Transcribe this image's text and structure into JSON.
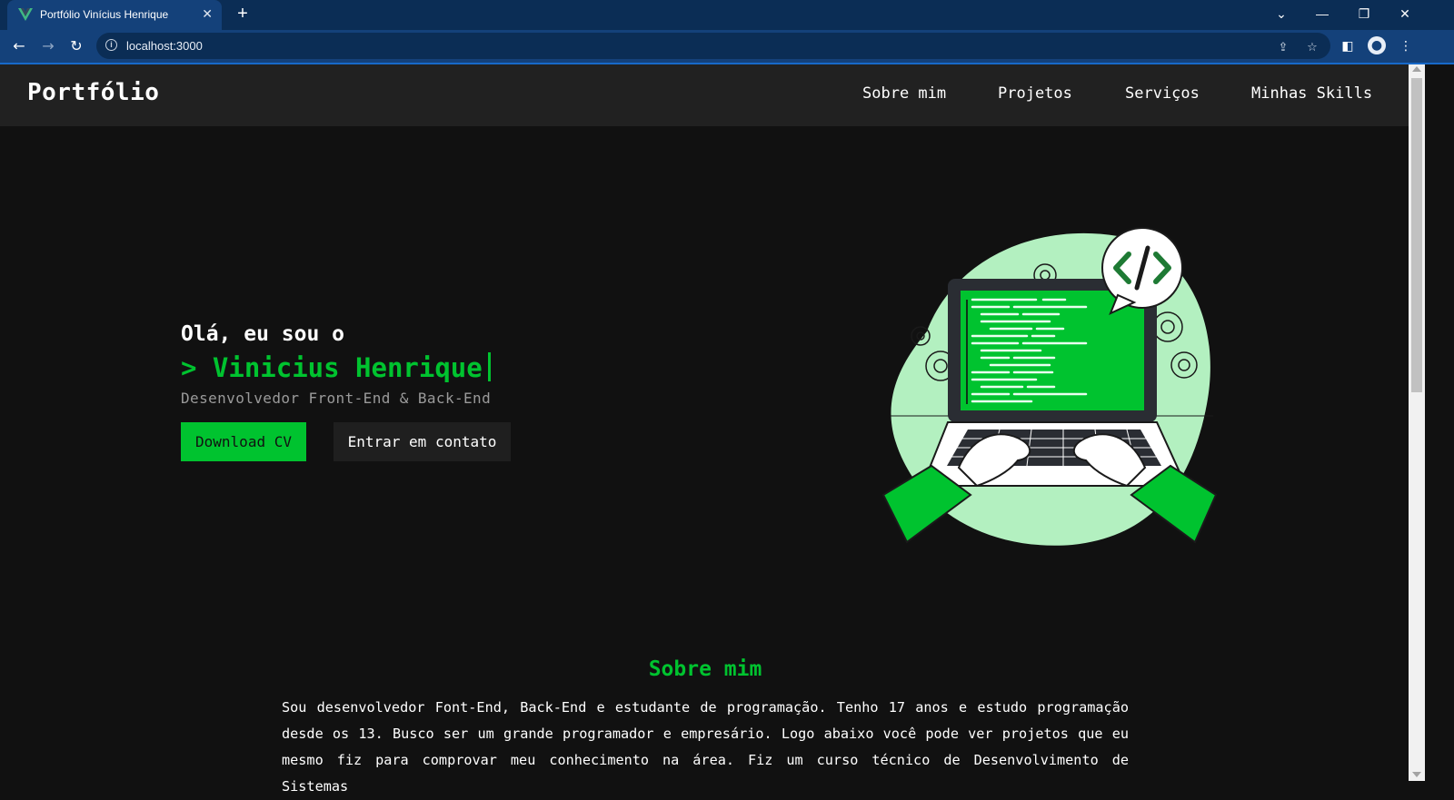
{
  "browser": {
    "tab_title": "Portfólio Vinícius Henrique",
    "url": "localhost:3000",
    "accent": "#1769c9"
  },
  "site": {
    "logo": "Portfólio",
    "nav": [
      {
        "label": "Sobre mim"
      },
      {
        "label": "Projetos"
      },
      {
        "label": "Serviços"
      },
      {
        "label": "Minhas Skills"
      }
    ],
    "colors": {
      "brand": "#00c32f",
      "background": "#111111",
      "header": "#212121"
    }
  },
  "hero": {
    "greeting": "Olá, eu sou o",
    "name": "> Vinicius Henrique",
    "role": "Desenvolvedor Front-End & Back-End",
    "download_label": "Download CV",
    "contact_label": "Entrar em contato",
    "illustration_icon": "laptop-coding-illustration"
  },
  "about": {
    "title": "Sobre mim",
    "text": "Sou desenvolvedor Font-End, Back-End e estudante de programação. Tenho 17 anos e estudo programação desde os 13. Busco ser um grande programador e empresário. Logo abaixo você pode ver projetos que eu mesmo fiz para comprovar meu conhecimento na área. Fiz um curso técnico de Desenvolvimento de Sistemas"
  }
}
